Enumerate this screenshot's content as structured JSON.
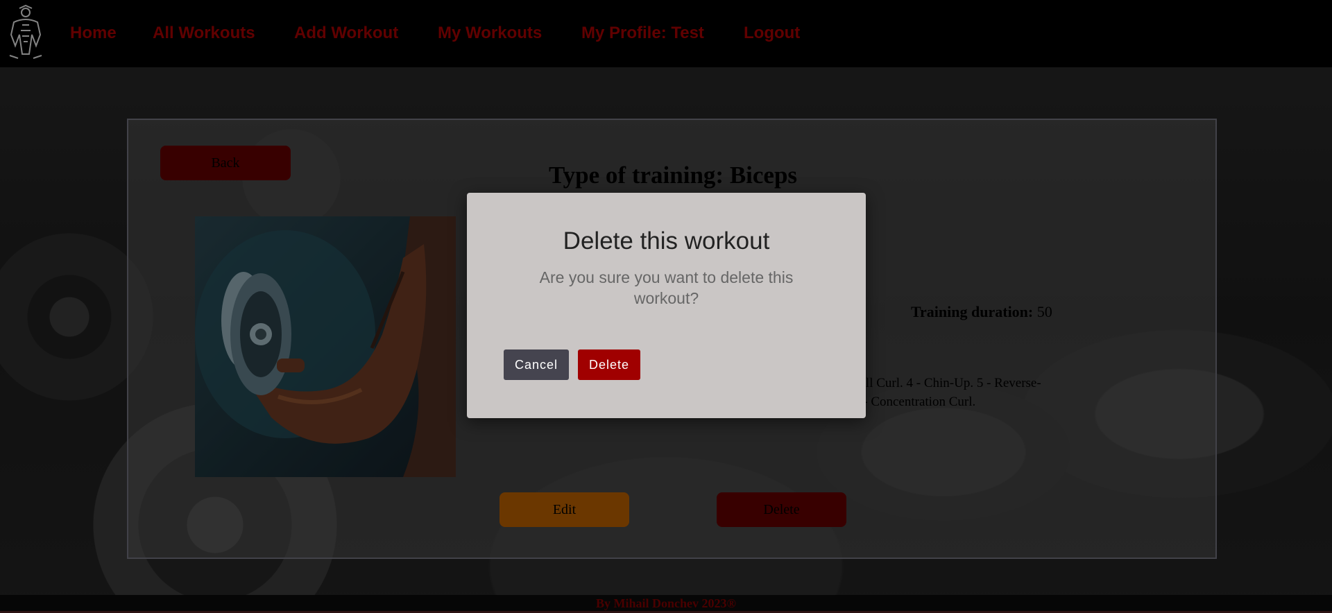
{
  "nav": {
    "links": [
      {
        "label": "Home"
      },
      {
        "label": "All Workouts"
      },
      {
        "label": "Add Workout"
      },
      {
        "label": "My Workouts"
      },
      {
        "label": "My Profile: Test"
      },
      {
        "label": "Logout"
      }
    ],
    "link_color": "#a10000"
  },
  "details": {
    "back_label": "Back",
    "title": "Type of training: Biceps",
    "duration_label": "Training duration:",
    "duration_value": "50",
    "exercises_line1": "bell Curl. 4 - Chin-Up. 5 - Reverse-",
    "exercises_line2": "8 - Concentration Curl.",
    "edit_label": "Edit",
    "delete_label": "Delete"
  },
  "modal": {
    "title": "Delete this workout",
    "text": "Are you sure you want to delete this workout?",
    "cancel_label": "Cancel",
    "delete_label": "Delete"
  },
  "footer": {
    "text": "By Mihail Donchev 2023®"
  },
  "colors": {
    "accent_red": "#a00000",
    "edit_orange": "#b35d00",
    "modal_bg": "#cac6c5"
  }
}
